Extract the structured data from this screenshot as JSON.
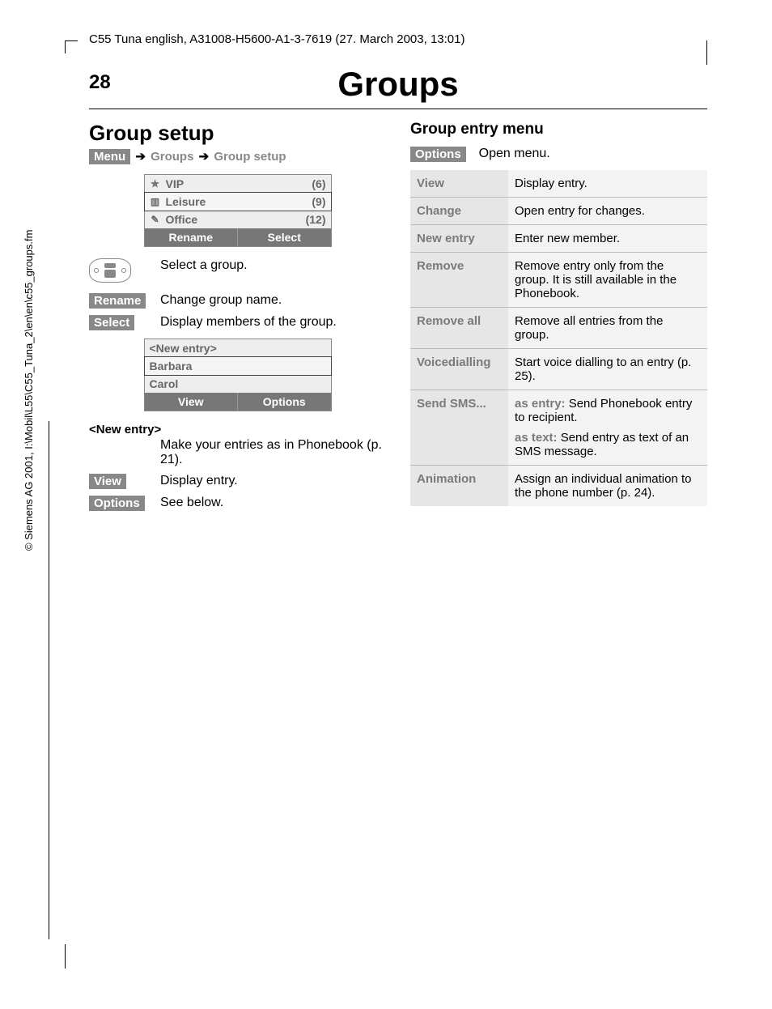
{
  "header": {
    "docinfo": "C55 Tuna english, A31008-H5600-A1-3-7619 (27. March 2003, 13:01)"
  },
  "page": {
    "number": "28",
    "title": "Groups"
  },
  "left": {
    "section_title": "Group setup",
    "breadcrumb": {
      "menu": "Menu",
      "groups": "Groups",
      "group_setup": "Group setup"
    },
    "screen1": {
      "rows": [
        {
          "icon": "star-icon",
          "label": "VIP",
          "count": "(6)"
        },
        {
          "icon": "leisure-icon",
          "label": "Leisure",
          "count": "(9)"
        },
        {
          "icon": "office-icon",
          "label": "Office",
          "count": "(12)"
        }
      ],
      "softkeys": {
        "left": "Rename",
        "right": "Select"
      }
    },
    "defs1": {
      "navkey": "Select a group.",
      "rename_key": "Rename",
      "rename_desc": "Change group name.",
      "select_key": "Select",
      "select_desc": "Display members of the group."
    },
    "screen2": {
      "rows": [
        {
          "label": "<New entry>"
        },
        {
          "label": "Barbara"
        },
        {
          "label": "Carol"
        }
      ],
      "softkeys": {
        "left": "View",
        "right": "Options"
      }
    },
    "defs2": {
      "newentry_key": "<New entry>",
      "newentry_desc": "Make your entries as in Phonebook (p. 21).",
      "view_key": "View",
      "view_desc": "Display entry.",
      "options_key": "Options",
      "options_desc": "See below."
    }
  },
  "right": {
    "subsection_title": "Group entry menu",
    "options_key": "Options",
    "options_desc": "Open menu.",
    "table": [
      {
        "k": "View",
        "v": "Display entry."
      },
      {
        "k": "Change",
        "v": "Open entry for changes."
      },
      {
        "k": "New entry",
        "v": "Enter new member."
      },
      {
        "k": "Remove",
        "v": "Remove entry only from the group. It is still available in the Phonebook."
      },
      {
        "k": "Remove all",
        "v": "Remove all entries from the group."
      },
      {
        "k": "Voicedialling",
        "v": "Start voice dialling to an entry (p. 25)."
      },
      {
        "k": "Send SMS...",
        "v_parts": [
          {
            "b": "as entry:",
            "t": " Send Phonebook entry to recipient."
          },
          {
            "b": "as text:",
            "t": " Send entry as text of an SMS message."
          }
        ]
      },
      {
        "k": "Animation",
        "v": "Assign an individual animation to the phone number (p. 24)."
      }
    ]
  },
  "footer": {
    "credit": "© Siemens AG 2001, I:\\Mobil\\L55\\C55_Tuna_2\\en\\en\\c55_groups.fm"
  }
}
